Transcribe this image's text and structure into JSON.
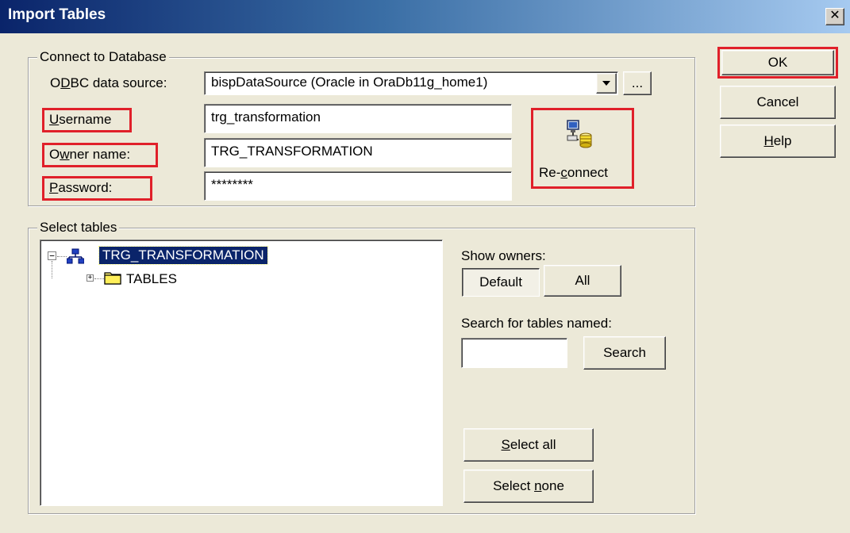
{
  "window": {
    "title": "Import Tables",
    "close_glyph": "✕"
  },
  "connect": {
    "legend": "Connect to Database",
    "odbc_label": "ODBC data source:",
    "odbc_value": "bispDataSource (Oracle in OraDb11g_home1)",
    "browse_label": "...",
    "username_label": "Username",
    "username_value": "trg_transformation",
    "owner_label": "Owner name:",
    "owner_value": "TRG_TRANSFORMATION",
    "password_label": "Password:",
    "password_value": "********",
    "reconnect_label": "Re-connect"
  },
  "select": {
    "legend": "Select tables",
    "tree": {
      "root_label": "TRG_TRANSFORMATION",
      "child_label": "TABLES"
    },
    "show_owners_label": "Show owners:",
    "default_label": "Default",
    "all_label": "All",
    "search_label": "Search for tables named:",
    "search_value": "",
    "search_button": "Search",
    "select_all": "Select all",
    "select_none": "Select none"
  },
  "actions": {
    "ok": "OK",
    "cancel": "Cancel",
    "help": "Help"
  },
  "colors": {
    "highlight_box": "#e0202a",
    "selection": "#0a246a"
  }
}
